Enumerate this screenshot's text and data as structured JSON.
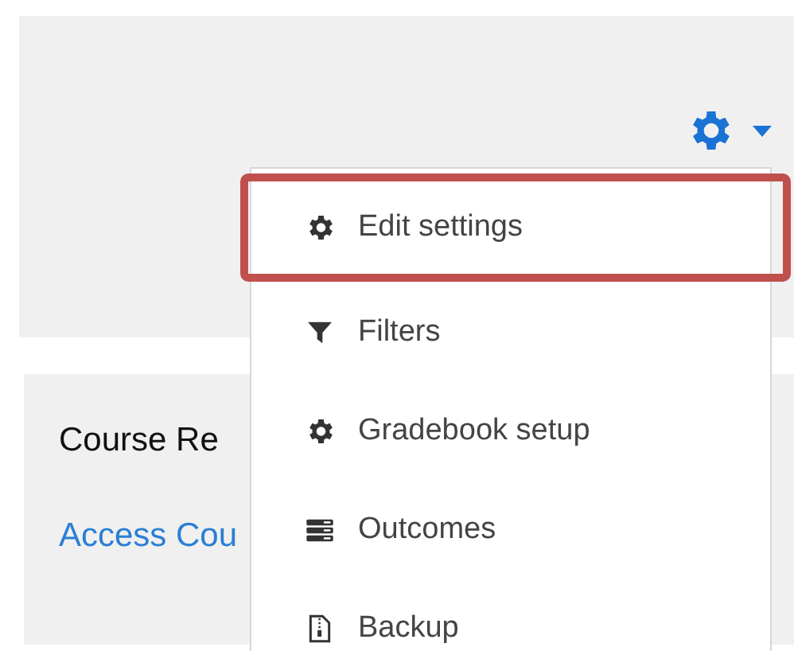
{
  "header_panel": {
    "settings_menu_button": {
      "expanded": true
    }
  },
  "course_card": {
    "title": "Course Re",
    "link": "Access Cou"
  },
  "menu": [
    {
      "kind": "gear",
      "label": "Edit settings",
      "highlighted": true
    },
    {
      "kind": "filter",
      "label": "Filters",
      "highlighted": false
    },
    {
      "kind": "gear",
      "label": "Gradebook setup",
      "highlighted": false
    },
    {
      "kind": "outcomes",
      "label": "Outcomes",
      "highlighted": false
    },
    {
      "kind": "backup",
      "label": "Backup",
      "highlighted": false
    }
  ]
}
